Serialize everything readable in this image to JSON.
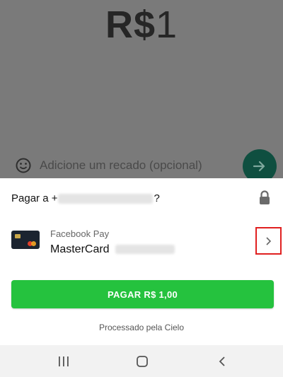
{
  "background": {
    "amount_prefix": "R$",
    "amount_value": "1",
    "memo_placeholder": "Adicione um recado (opcional)"
  },
  "sheet": {
    "pay_to_prefix": "Pagar a +",
    "pay_to_suffix": "?",
    "provider": "Facebook Pay",
    "card_name": "MasterCard",
    "pay_button": "PAGAR R$ 1,00",
    "processed_by": "Processado pela Cielo"
  },
  "colors": {
    "overlay": "#7a7a7a",
    "send_button": "#0f4f40",
    "pay_button": "#25c23e",
    "highlight": "#e02020"
  },
  "icons": [
    "smiley-icon",
    "send-arrow-icon",
    "lock-icon",
    "chevron-right-icon",
    "recent-apps-icon",
    "home-icon",
    "back-icon"
  ]
}
